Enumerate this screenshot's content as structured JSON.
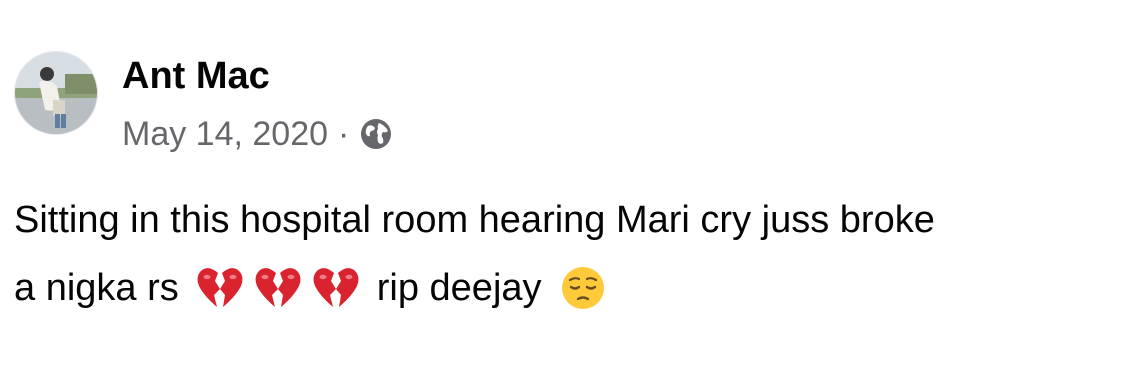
{
  "post": {
    "author_name": "Ant Mac",
    "date": "May 14, 2020",
    "separator": "·",
    "privacy_icon": "globe-icon",
    "text_line1": "Sitting in this hospital room hearing Mari cry juss broke",
    "text_line2_start": "a nigka rs",
    "text_line2_end": "rip deejay",
    "emojis": [
      "broken-heart-emoji",
      "broken-heart-emoji",
      "broken-heart-emoji",
      "pensive-face-emoji"
    ]
  },
  "colors": {
    "primary_text": "#050505",
    "secondary_text": "#65676b",
    "heart_red": "#d9242f",
    "emoji_yellow": "#ffca3a"
  }
}
